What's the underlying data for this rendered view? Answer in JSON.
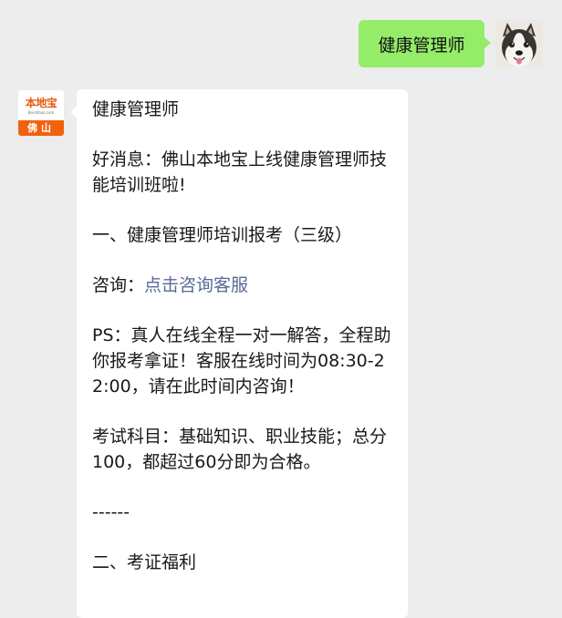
{
  "outgoing": {
    "text": "健康管理师"
  },
  "incoming": {
    "avatar": {
      "brand": "本地宝",
      "domain": "Bendibao.com",
      "city": "佛山"
    },
    "lines": {
      "l1": "健康管理师",
      "l2": "好消息：佛山本地宝上线健康管理师技能培训班啦!",
      "l3": "一、健康管理师培训报考（三级）",
      "l4_prefix": "咨询：",
      "l4_link": "点击咨询客服",
      "l5": "PS：真人在线全程一对一解答，全程助你报考拿证！客服在线时间为08:30-22:00，请在此时间内咨询！",
      "l6": "考试科目：基础知识、职业技能；总分100，都超过60分即为合格。",
      "l7": "------",
      "l8": "二、考证福利"
    }
  },
  "colors": {
    "background": "#ededed",
    "outgoing_bubble": "#95ec69",
    "incoming_bubble": "#ffffff",
    "link": "#576b95",
    "brand_orange": "#f2620c"
  }
}
